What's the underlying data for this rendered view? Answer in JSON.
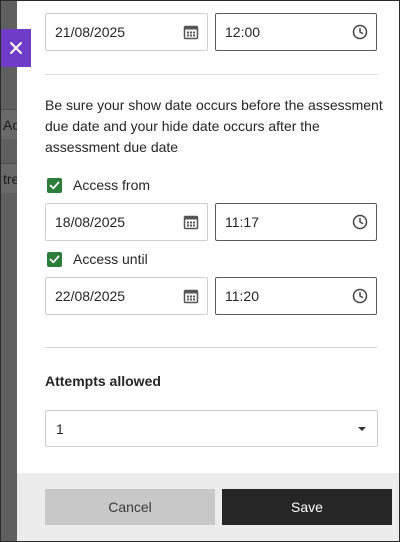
{
  "backdrop": {
    "rows": [
      "Ac",
      "tre"
    ]
  },
  "show_date": {
    "date": "21/08/2025",
    "time": "12:00"
  },
  "note": "Be sure your show date occurs before the assessment due date and your hide date occurs after the assessment due date",
  "access_from": {
    "label": "Access from",
    "checked": true,
    "date": "18/08/2025",
    "time": "11:17"
  },
  "access_until": {
    "label": "Access until",
    "checked": true,
    "date": "22/08/2025",
    "time": "11:20"
  },
  "attempts": {
    "label": "Attempts allowed",
    "value": "1"
  },
  "footer": {
    "cancel_label": "Cancel",
    "save_label": "Save"
  },
  "colors": {
    "accent_purple": "#6f3cc7",
    "checkbox_green": "#2d7d3a",
    "save_button": "#262626",
    "cancel_button": "#c8c8c8"
  },
  "icons": {
    "close": "close-icon",
    "calendar": "calendar-icon",
    "clock": "clock-icon",
    "check": "checkmark-icon",
    "dropdown": "caret-down-icon"
  }
}
